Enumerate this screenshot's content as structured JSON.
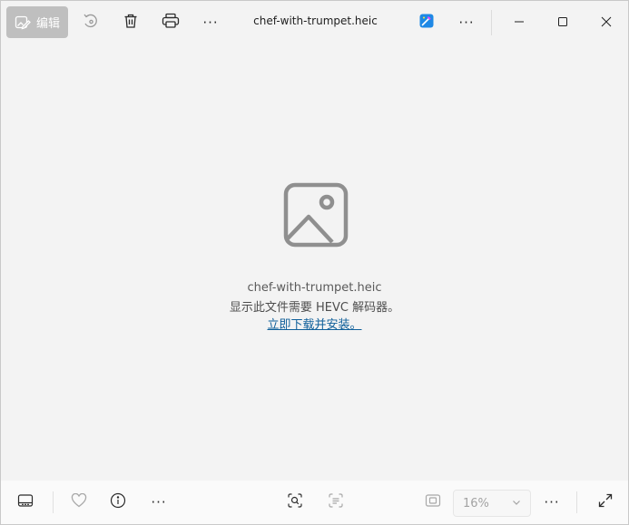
{
  "toolbar": {
    "edit_label": "编辑",
    "more_label": "···"
  },
  "window": {
    "title": "chef-with-trumpet.heic"
  },
  "content": {
    "filename": "chef-with-trumpet.heic",
    "message": "显示此文件需要 HEVC 解码器。",
    "link": "立即下载并安装。"
  },
  "bottombar": {
    "more_label": "···",
    "zoom_value": "16%"
  },
  "colors": {
    "accent_link": "#0f5f9a",
    "edit_button_bg": "#bfbfbf",
    "placeholder_icon": "#8f8f8f"
  },
  "icons": {
    "edit": "edit-image-icon",
    "rotate": "rotate-icon",
    "delete": "trash-icon",
    "print": "printer-icon",
    "designer": "designer-app-icon",
    "minimize": "minimize-icon",
    "maximize": "maximize-icon",
    "close": "close-icon",
    "filmstrip": "filmstrip-icon",
    "favorite": "heart-icon",
    "info": "info-icon",
    "visual_search": "visual-search-icon",
    "text_scan": "text-scan-icon",
    "actual_size": "actual-size-icon",
    "fullscreen": "fullscreen-icon",
    "placeholder": "image-placeholder-icon"
  }
}
